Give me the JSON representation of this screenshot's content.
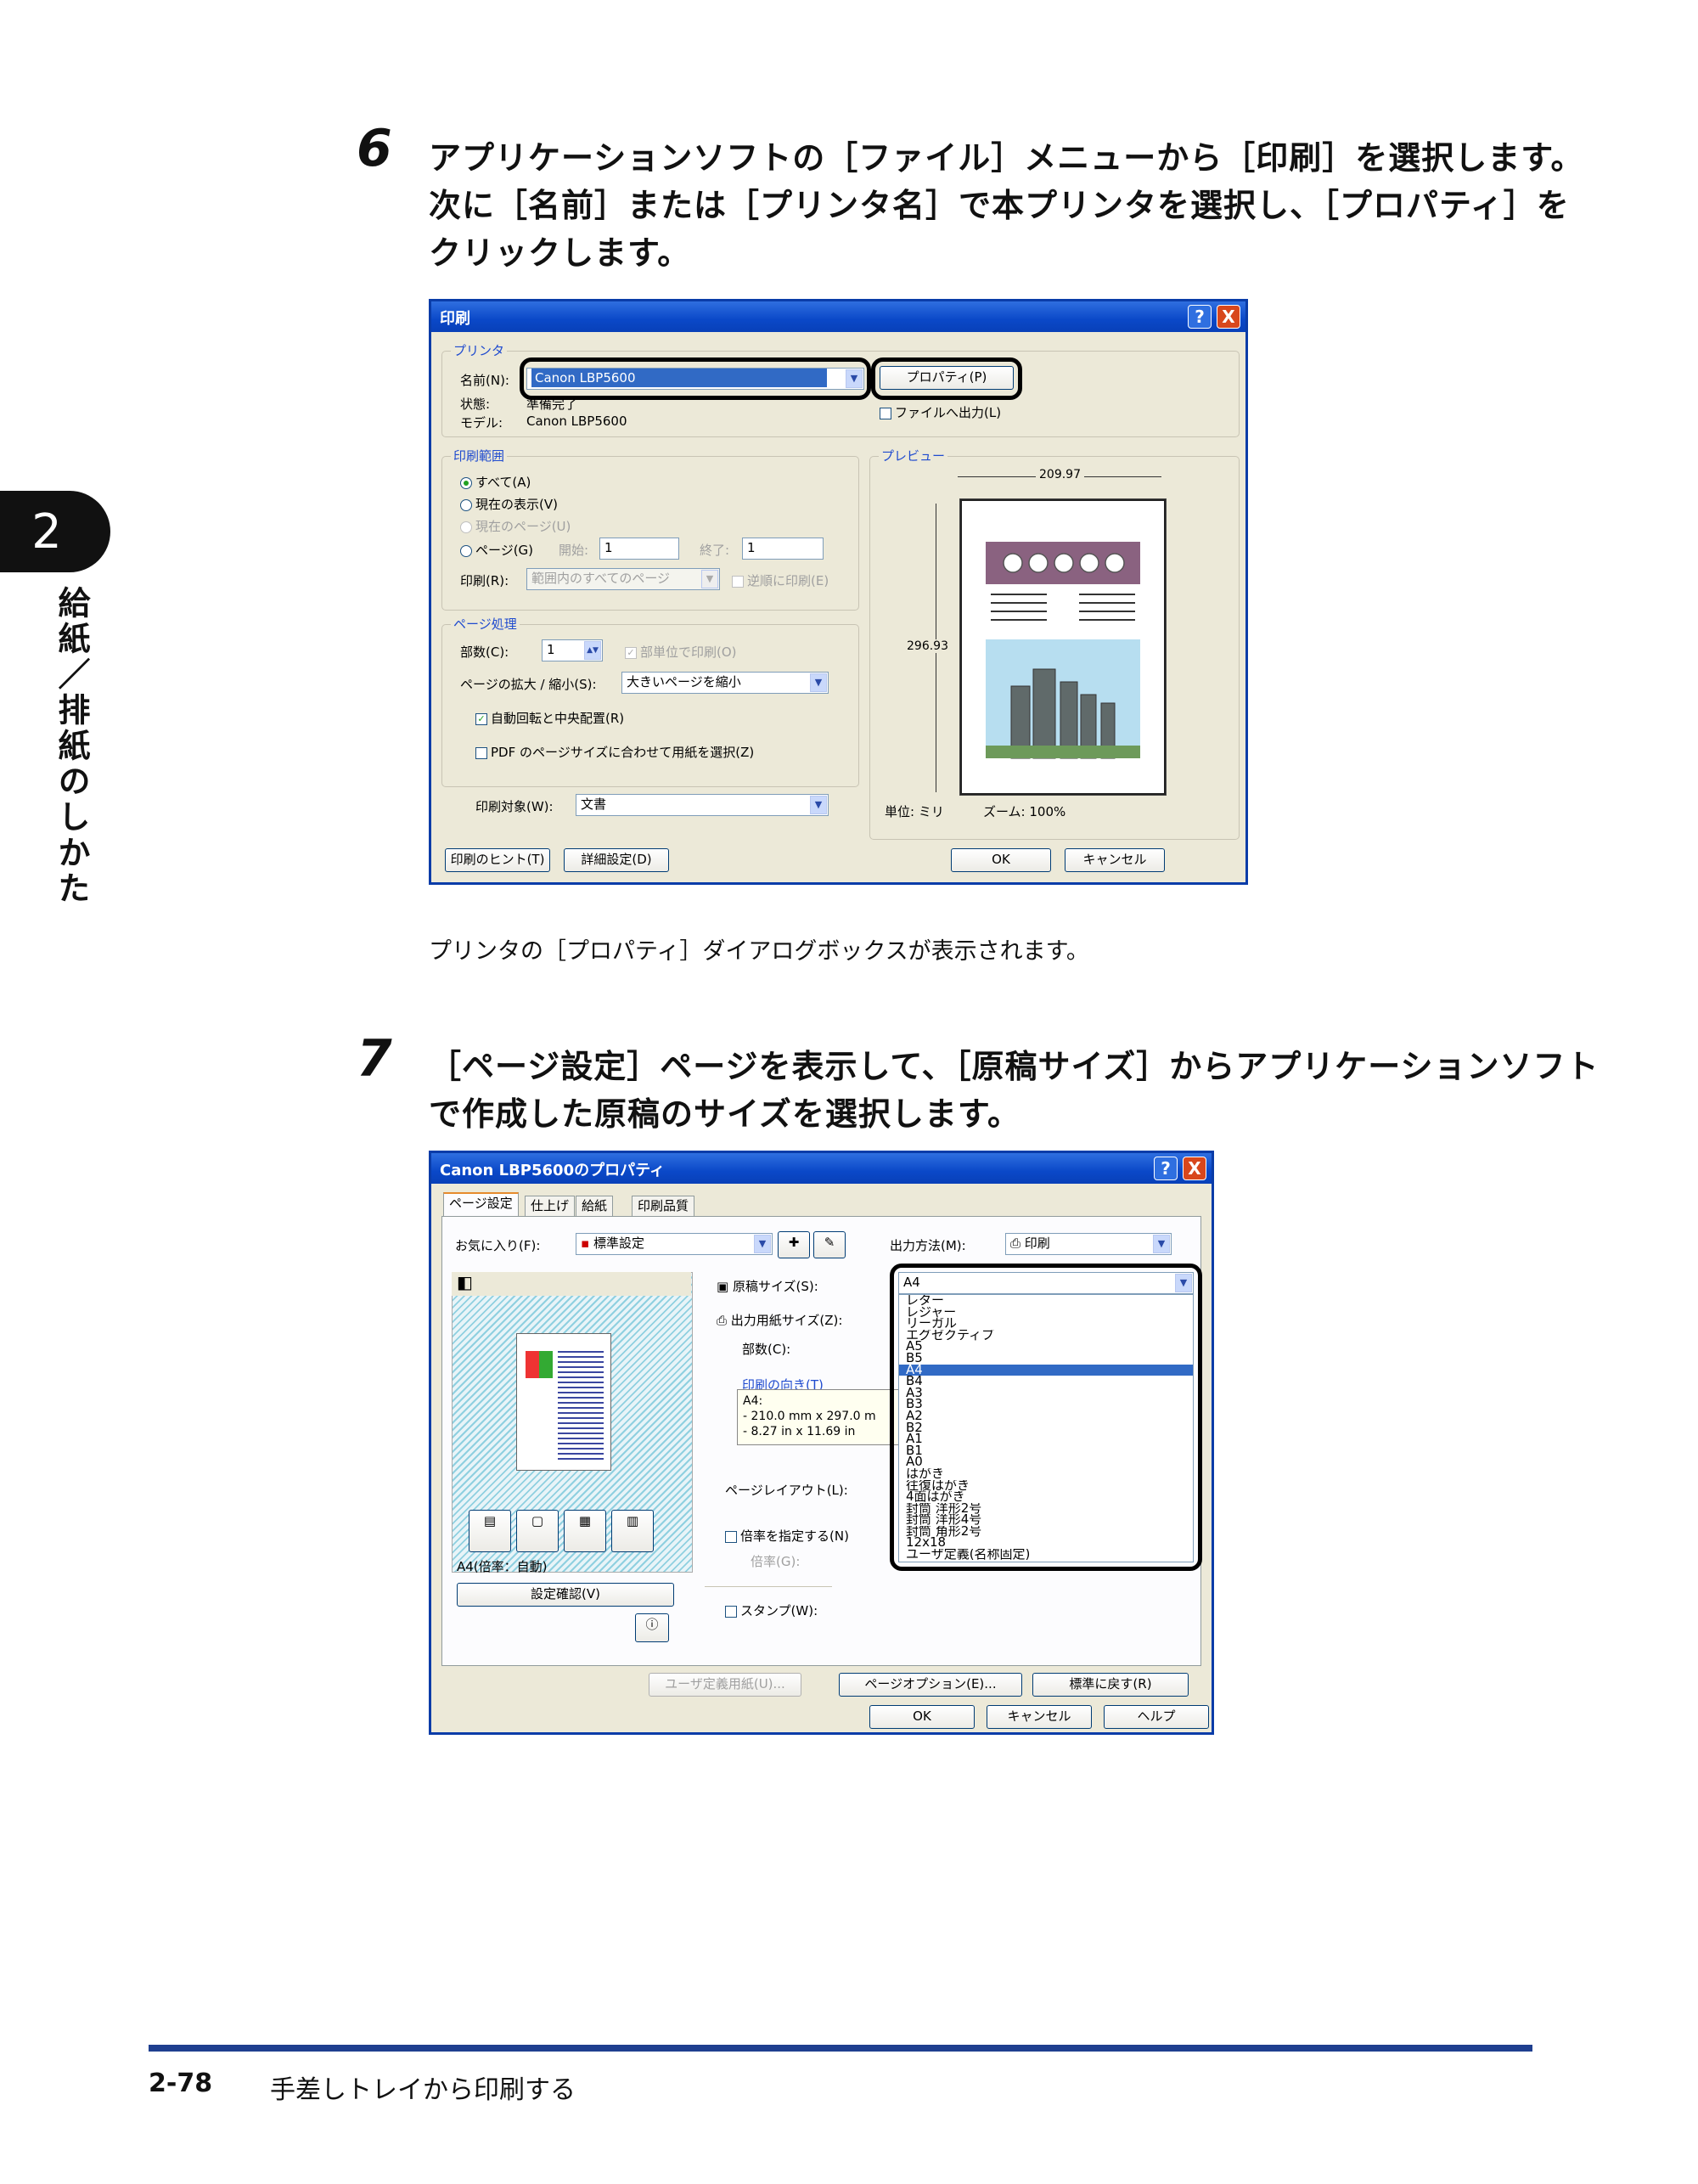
{
  "chapter": {
    "number": "2",
    "title": "給紙／排紙のしかた"
  },
  "step6": {
    "number": "6",
    "text": "アプリケーションソフトの［ファイル］メニューから［印刷］を選択します。次に［名前］または［プリンタ名］で本プリンタを選択し、［プロパティ］をクリックします。",
    "note": "プリンタの［プロパティ］ダイアログボックスが表示されます。"
  },
  "step7": {
    "number": "7",
    "text": "［ページ設定］ページを表示して、［原稿サイズ］からアプリケーションソフトで作成した原稿のサイズを選択します。"
  },
  "print_dialog": {
    "title": "印刷",
    "help_btn": "?",
    "close_btn": "X",
    "printer_group": "プリンタ",
    "name_label": "名前(N):",
    "name_value": "Canon LBP5600",
    "properties_btn": "プロパティ(P)",
    "status_label": "状態:",
    "status_value": "準備完了",
    "model_label": "モデル:",
    "model_value": "Canon LBP5600",
    "print_to_file": "ファイルへ出力(L)",
    "range_group": "印刷範囲",
    "range_all": "すべて(A)",
    "range_current_view": "現在の表示(V)",
    "range_current_page": "現在のページ(U)",
    "range_pages": "ページ(G)",
    "from_label": "開始:",
    "from_value": "1",
    "to_label": "終了:",
    "to_value": "1",
    "print_label": "印刷(R):",
    "print_value": "範囲内のすべてのページ",
    "reverse_label": "逆順に印刷(E)",
    "handling_group": "ページ処理",
    "copies_label": "部数(C):",
    "copies_value": "1",
    "collate_label": "部単位で印刷(O)",
    "scale_label": "ページの拡大 / 縮小(S):",
    "scale_value": "大きいページを縮小",
    "autorotate_label": "自動回転と中央配置(R)",
    "pdf_size_label": "PDF のページサイズに合わせて用紙を選択(Z)",
    "print_what_label": "印刷対象(W):",
    "print_what_value": "文書",
    "preview_group": "プレビュー",
    "preview_width": "209.97",
    "preview_height": "296.93",
    "unit_label": "単位: ミリ",
    "zoom_label": "ズーム: 100%",
    "tips_btn": "印刷のヒント(T)",
    "advanced_btn": "詳細設定(D)",
    "ok_btn": "OK",
    "cancel_btn": "キャンセル"
  },
  "props_dialog": {
    "title": "Canon LBP5600のプロパティ",
    "help_btn": "?",
    "close_btn": "X",
    "tabs": [
      "ページ設定",
      "仕上げ",
      "給紙",
      "印刷品質"
    ],
    "favorites_label": "お気に入り(F):",
    "favorites_value": "標準設定",
    "output_label": "出力方法(M):",
    "output_value": "印刷",
    "orig_size_label": "原稿サイズ(S):",
    "orig_size_value": "A4",
    "paper_size_label": "出力用紙サイズ(Z):",
    "copies_label": "部数(C):",
    "orientation_label": "印刷の向き(T)",
    "info_lines": [
      "A4:",
      "- 210.0 mm x 297.0 m",
      "- 8.27 in x 11.69 in"
    ],
    "layout_label": "ページレイアウト(L):",
    "scale_label": "倍率を指定する(N)",
    "scale_sub": "倍率(G):",
    "stamp_label": "スタンプ(W):",
    "preview_caption": "A4(倍率：自動)",
    "confirm_btn": "設定確認(V)",
    "custom_paper_btn": "ユーザ定義用紙(U)...",
    "page_options_btn": "ページオプション(E)...",
    "restore_btn": "標準に戻す(R)",
    "ok_btn": "OK",
    "cancel_btn": "キャンセル",
    "help_bottom_btn": "ヘルプ",
    "size_options": [
      "レター",
      "レジャー",
      "リーガル",
      "エグゼクティブ",
      "A5",
      "B5",
      "A4",
      "B4",
      "A3",
      "B3",
      "A2",
      "B2",
      "A1",
      "B1",
      "A0",
      "はがき",
      "往復はがき",
      "4面はがき",
      "封筒 洋形2号",
      "封筒 洋形4号",
      "封筒 角形2号",
      "12x18",
      "ユーザ定義(名称固定)"
    ],
    "selected_option": "A4"
  },
  "footer": {
    "page": "2-78",
    "title": "手差しトレイから印刷する"
  },
  "colors": {
    "accent": "#0a3ca8",
    "footer_rule": "#1f3f8f",
    "selection": "#316ac5"
  }
}
